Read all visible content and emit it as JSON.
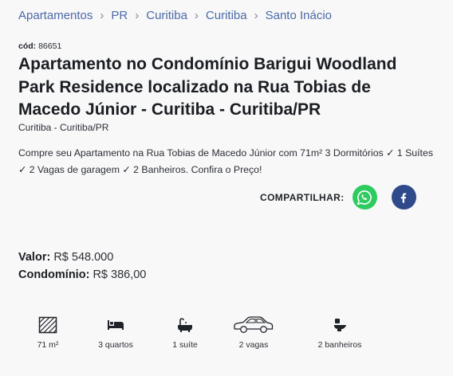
{
  "breadcrumb": [
    "Apartamentos",
    "PR",
    "Curitiba",
    "Curitiba",
    "Santo Inácio"
  ],
  "code": {
    "label": "cód:",
    "value": "86651"
  },
  "title": "Apartamento no Condomínio Barigui Woodland Park Residence localizado na Rua Tobias de Macedo Júnior - Curitiba - Curitiba/PR",
  "location": "Curitiba - Curitiba/PR",
  "description": "Compre seu Apartamento na Rua Tobias de Macedo Júnior com 71m² 3 Dormitórios ✓ 1 Suítes ✓ 2 Vagas de garagem ✓ 2 Banheiros. Confira o Preço!",
  "share": {
    "label": "COMPARTILHAR:",
    "buttons": [
      {
        "icon": "whatsapp-icon",
        "color": "#2ecc60"
      },
      {
        "icon": "facebook-icon",
        "color": "#2f4a8a"
      }
    ]
  },
  "prices": {
    "valor_label": "Valor:",
    "valor": "R$ 548.000",
    "condominio_label": "Condomínio:",
    "condominio": "R$ 386,00"
  },
  "features": [
    {
      "icon": "area-icon",
      "value": "71 m²"
    },
    {
      "icon": "bed-icon",
      "value": "3 quartos"
    },
    {
      "icon": "bathtub-icon",
      "value": "1 suíte"
    },
    {
      "icon": "car-icon",
      "value": "2 vagas"
    },
    {
      "icon": "toilet-icon",
      "value": "2 banheiros"
    }
  ],
  "colors": {
    "link": "#4a6aa5",
    "text": "#1f2328",
    "whatsapp": "#2ecc60",
    "facebook": "#2f4a8a"
  }
}
